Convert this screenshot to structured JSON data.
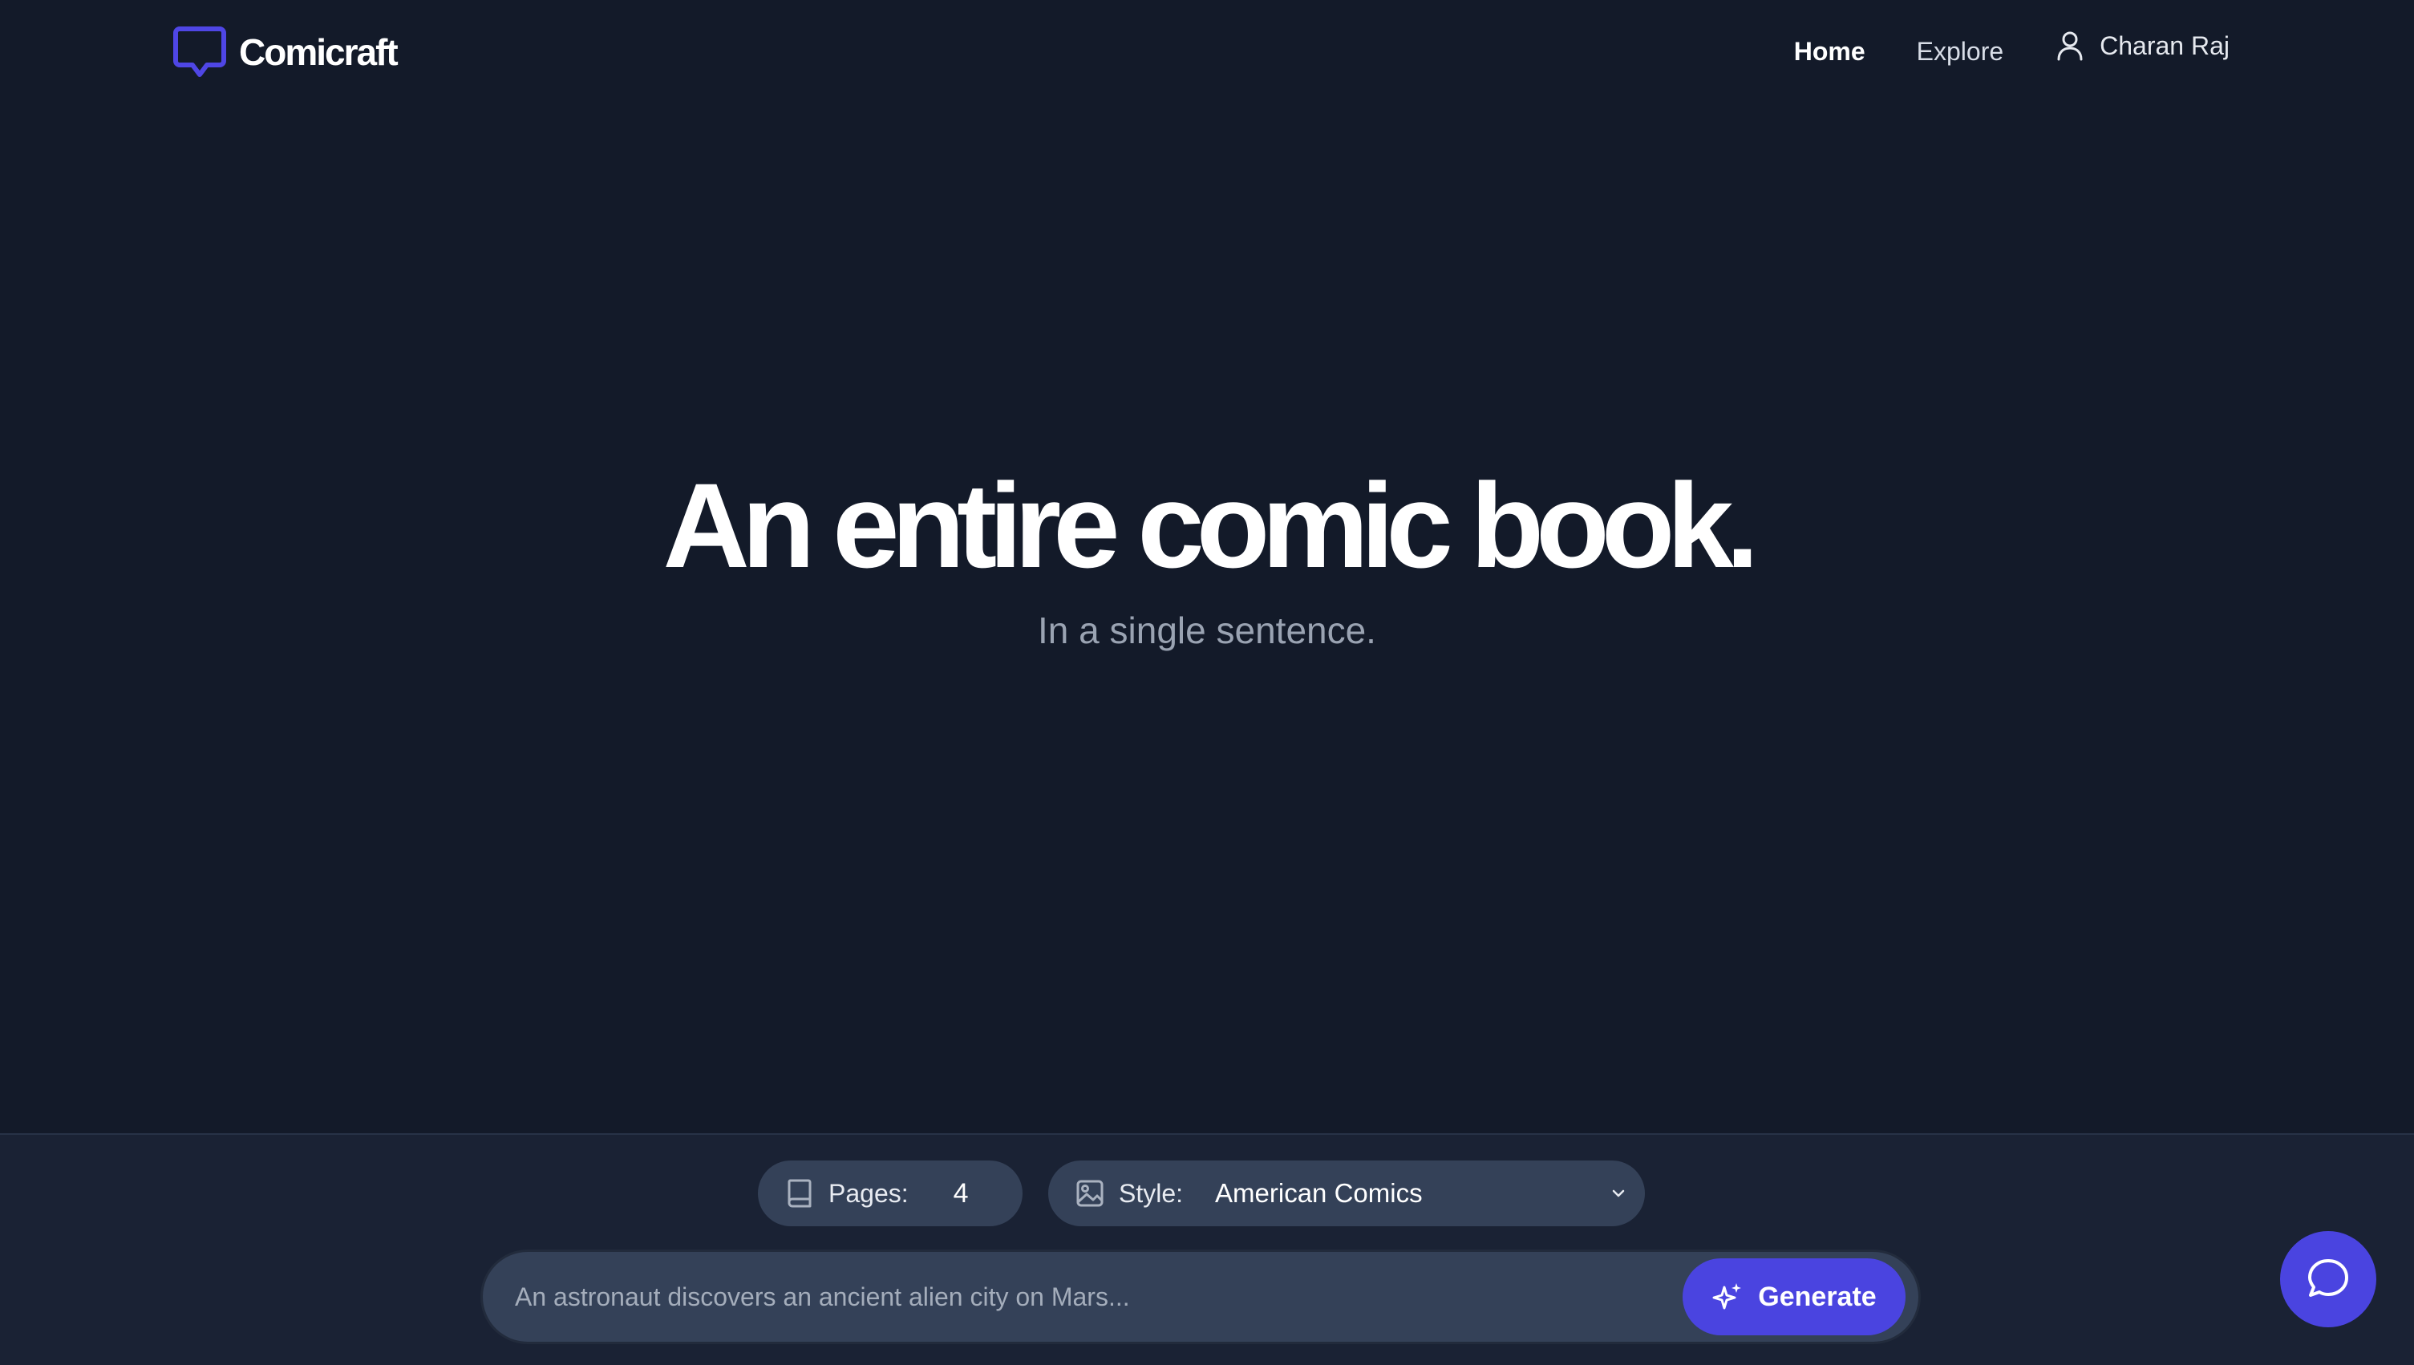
{
  "app": {
    "brand": "Comicraft",
    "accent_color": "#4a44e0",
    "background_color": "#131a29"
  },
  "header": {
    "logo_icon": "speech-bubble-icon",
    "nav": {
      "home_label": "Home",
      "explore_label": "Explore",
      "user_name": "Charan Raj",
      "user_icon": "user-icon"
    }
  },
  "hero": {
    "title": "An entire comic book.",
    "subtitle": "In a single sentence."
  },
  "controls": {
    "pages": {
      "icon": "book-icon",
      "label": "Pages:",
      "value": "4"
    },
    "style": {
      "icon": "image-icon",
      "label": "Style:",
      "value": "American Comics",
      "dropdown_icon": "chevron-down-icon"
    }
  },
  "prompt": {
    "placeholder": "An astronaut discovers an ancient alien city on Mars...",
    "value": "",
    "generate_label": "Generate",
    "generate_icon": "sparkle-icon"
  },
  "chat": {
    "icon": "chat-bubble-icon"
  }
}
